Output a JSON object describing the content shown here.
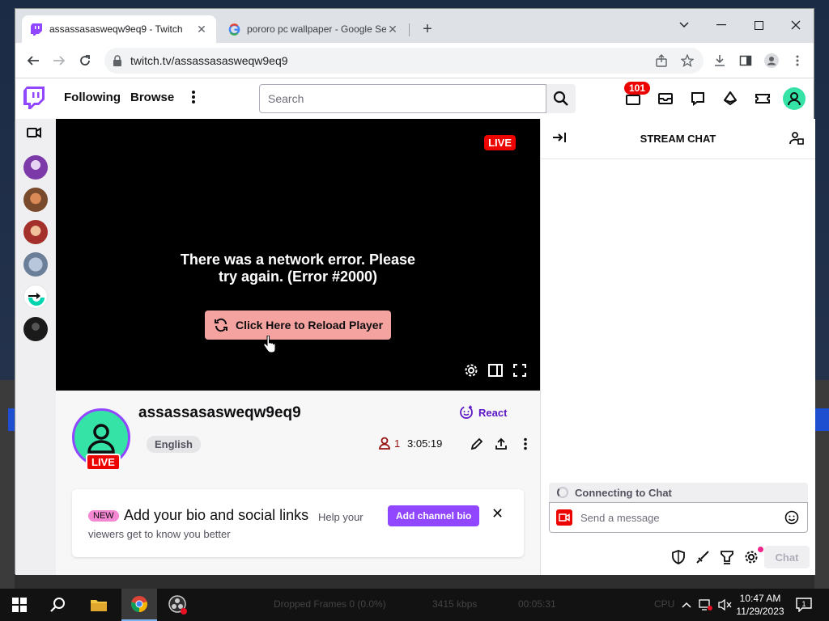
{
  "browser": {
    "active_tab_title": "assassasasweqw9eq9 - Twitch",
    "inactive_tab_title": "pororo pc wallpaper - Google Se",
    "url": "twitch.tv/assassasasweqw9eq9"
  },
  "twitch": {
    "nav": {
      "following": "Following",
      "browse": "Browse",
      "search_placeholder": "Search",
      "notification_count": "101"
    },
    "player": {
      "live_label": "LIVE",
      "error_line1": "There was a network error. Please",
      "error_line2": "try again. (Error #2000)",
      "reload_label": "Click Here to Reload Player"
    },
    "channel": {
      "name": "assassasasweqw9eq9",
      "live_label": "LIVE",
      "language": "English",
      "react_label": "React",
      "viewer_count": "1",
      "uptime": "3:05:19"
    },
    "bio_card": {
      "new_label": "NEW",
      "heading": "Add your bio and social links",
      "help_text": "Help your",
      "sub_text": "viewers get to know you better",
      "button_label": "Add channel bio"
    },
    "chat": {
      "title": "STREAM CHAT",
      "connecting": "Connecting to Chat",
      "input_placeholder": "Send a message",
      "send_label": "Chat"
    }
  },
  "taskbar": {
    "obs_dropped_frames": "Dropped Frames 0 (0.0%)",
    "obs_bitrate": "3415 kbps",
    "obs_time": "00:05:31",
    "obs_cpu": "CPU",
    "time": "10:47 AM",
    "date": "11/29/2023",
    "notifications": "1"
  },
  "colors": {
    "twitch_purple": "#9147ff",
    "live_red": "#eb0400",
    "reload_button": "#f5a3a0",
    "avatar_green": "#34e3a5"
  }
}
